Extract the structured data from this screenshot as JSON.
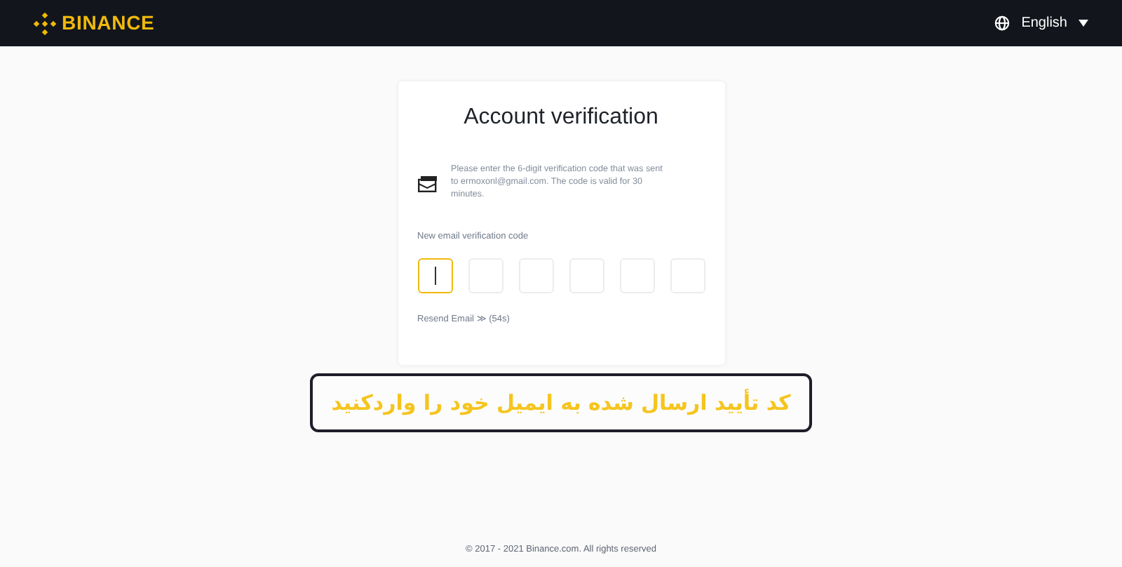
{
  "header": {
    "logo": "BINANCE",
    "language": "English"
  },
  "card": {
    "title": "Account verification",
    "notice": "Please enter the 6-digit verification code that was sent to ermoxonl@gmail.com. The code is valid for 30 minutes.",
    "field_label": "New email verification code",
    "code_boxes": [
      {
        "selected": true
      },
      {
        "selected": false
      },
      {
        "selected": false
      },
      {
        "selected": false
      },
      {
        "selected": false
      },
      {
        "selected": false
      }
    ],
    "resend": "Resend Email ≫ (54s)"
  },
  "caption": "کد تأیید ارسال شده به ایمیل خود را واردکنید",
  "footer": "© 2017 - 2021 Binance.com. All rights reserved"
}
